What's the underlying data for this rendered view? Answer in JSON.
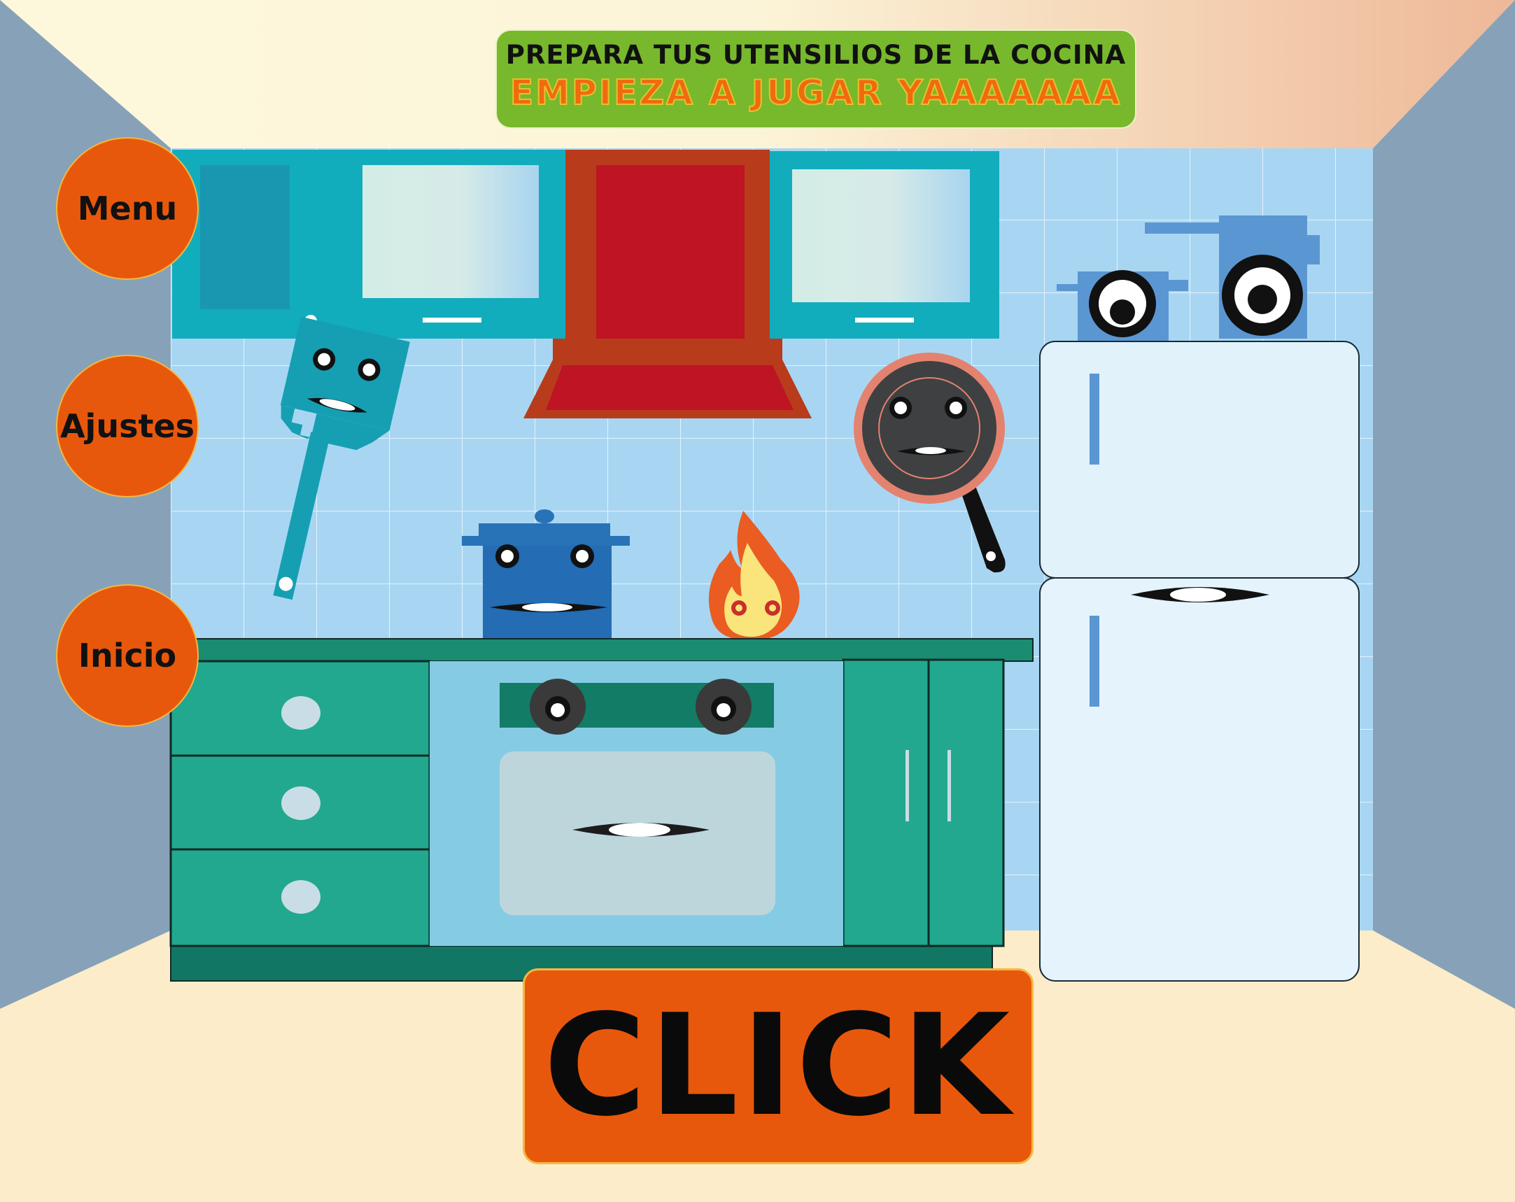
{
  "banner": {
    "line1": "PREPARA TUS UTENSILIOS DE LA COCINA",
    "line2": "EMPIEZA A JUGAR YAAAAAAA"
  },
  "nav": {
    "menu_label": "Menu",
    "settings_label": "Ajustes",
    "home_label": "Inicio"
  },
  "action": {
    "click_label": "CLICK"
  },
  "colors": {
    "banner_bg": "#77b82c",
    "banner_subtitle": "#f06a10",
    "button_orange": "#e8580c",
    "wall_tile": "#a8d6f2",
    "cabinet_teal": "#12adbd",
    "counter_green": "#22a88e",
    "hood_red": "#be1424"
  },
  "characters": [
    "spatula-character",
    "pot-character",
    "flame-character",
    "frying-pan-character",
    "oven-character",
    "fridge-character",
    "small-pot-character",
    "tall-pot-character"
  ]
}
